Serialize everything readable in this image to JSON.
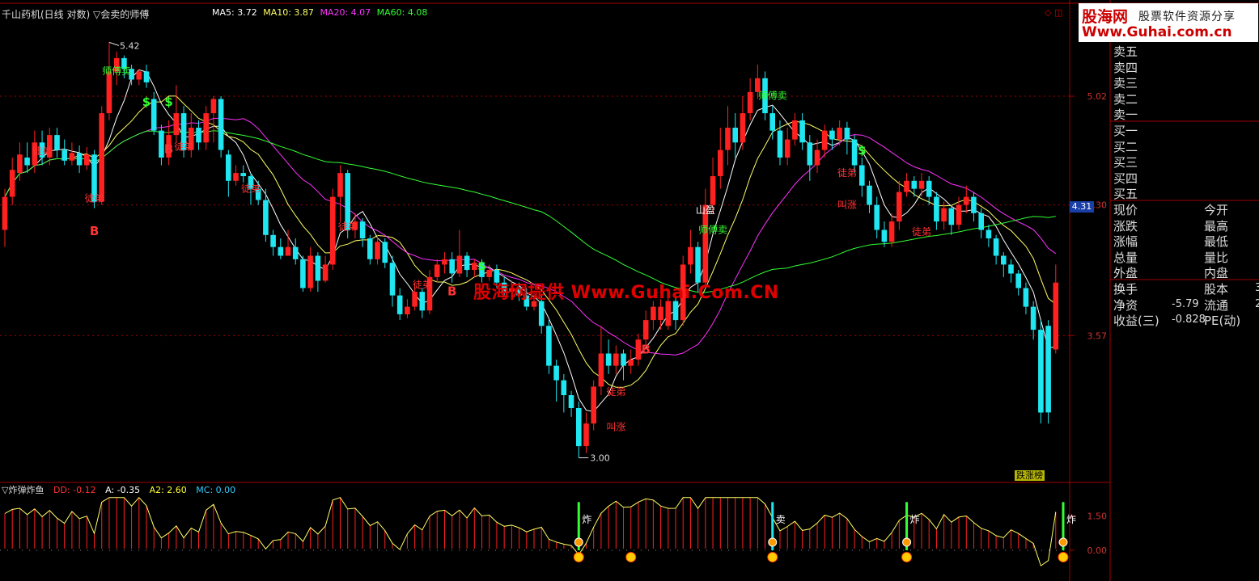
{
  "header": {
    "title": "千山药机(日线 对数) ▽会卖的师傅",
    "ma": [
      {
        "label": "MA5: 3.72",
        "color": "#ffffff"
      },
      {
        "label": "MA10: 3.87",
        "color": "#ffff66"
      },
      {
        "label": "MA20: 4.07",
        "color": "#ff33ff"
      },
      {
        "label": "MA60: 4.08",
        "color": "#33ff33"
      }
    ],
    "icons": "◇ ◫"
  },
  "logo": {
    "cn": "股海网",
    "sub": "股票软件资源分享",
    "url": "Www.Guhai.com.cn"
  },
  "watermark": "股海网提供 Www.Guhai.Com.CN",
  "indicator": {
    "name": "▽炸弹炸鱼",
    "values": [
      {
        "label": "DD: -0.12",
        "color": "#ff3333"
      },
      {
        "label": "A: -0.35",
        "color": "#ffffff"
      },
      {
        "label": "A2: 2.60",
        "color": "#ffff33"
      },
      {
        "label": "MC: 0.00",
        "color": "#33ccff"
      }
    ]
  },
  "quote": {
    "sell": [
      "卖五",
      "卖四",
      "卖三",
      "卖二",
      "卖一"
    ],
    "buy": [
      "买一",
      "买二",
      "买三",
      "买四",
      "买五"
    ],
    "left_labels": [
      "现价",
      "涨跌",
      "涨幅",
      "总量",
      "外盘"
    ],
    "right_labels": [
      "今开",
      "最高",
      "最低",
      "量比",
      "内盘"
    ],
    "extra_left": [
      "换手",
      "净资",
      "收益(三)"
    ],
    "extra_values": [
      "",
      "-5.79",
      "-0.828"
    ],
    "extra_right": [
      "股本",
      "流通",
      "PE(动)"
    ],
    "extra_right_vals": [
      "3",
      "2",
      ""
    ]
  },
  "price_tag": "4.31",
  "fall_rank": "跌涨榜",
  "chart_data": {
    "type": "candlestick",
    "title": "千山药机(日线 对数)",
    "y_axis_ticks": [
      5.02,
      4.3,
      3.57
    ],
    "y_axis_tick_labels": [
      "5.02",
      "4.30",
      "3.57"
    ],
    "ylim": [
      2.9,
      5.6
    ],
    "scale": "log",
    "high_label": "5.42",
    "low_label": "3.00",
    "candles": [
      [
        4.15,
        4.35,
        4.4,
        4.05
      ],
      [
        4.35,
        4.52,
        4.6,
        4.3
      ],
      [
        4.5,
        4.62,
        4.7,
        4.45
      ],
      [
        4.6,
        4.55,
        4.7,
        4.5
      ],
      [
        4.55,
        4.7,
        4.78,
        4.5
      ],
      [
        4.7,
        4.6,
        4.78,
        4.55
      ],
      [
        4.6,
        4.75,
        4.8,
        4.55
      ],
      [
        4.75,
        4.65,
        4.8,
        4.6
      ],
      [
        4.65,
        4.58,
        4.72,
        4.55
      ],
      [
        4.58,
        4.63,
        4.7,
        4.55
      ],
      [
        4.63,
        4.55,
        4.68,
        4.5
      ],
      [
        4.55,
        4.62,
        4.67,
        4.52
      ],
      [
        4.62,
        4.32,
        4.65,
        4.28
      ],
      [
        4.32,
        4.9,
        4.95,
        4.3
      ],
      [
        4.9,
        5.2,
        5.42,
        4.85
      ],
      [
        5.2,
        5.3,
        5.35,
        5.1
      ],
      [
        5.3,
        5.22,
        5.32,
        5.15
      ],
      [
        5.22,
        5.14,
        5.25,
        5.1
      ],
      [
        5.14,
        5.2,
        5.22,
        5.1
      ],
      [
        5.2,
        5.12,
        5.25,
        5.08
      ],
      [
        5.0,
        4.78,
        5.05,
        4.75
      ],
      [
        4.78,
        4.6,
        4.82,
        4.55
      ],
      [
        4.6,
        4.75,
        4.85,
        4.55
      ],
      [
        4.75,
        4.9,
        5.1,
        4.7
      ],
      [
        4.9,
        4.65,
        4.95,
        4.6
      ],
      [
        4.65,
        4.8,
        4.9,
        4.6
      ],
      [
        4.8,
        4.7,
        4.85,
        4.65
      ],
      [
        4.7,
        4.9,
        4.95,
        4.65
      ],
      [
        4.9,
        5.0,
        5.02,
        4.7
      ],
      [
        5.0,
        4.65,
        5.02,
        4.6
      ],
      [
        4.62,
        4.45,
        4.65,
        4.35
      ],
      [
        4.45,
        4.5,
        4.55,
        4.42
      ],
      [
        4.5,
        4.48,
        4.55,
        4.44
      ],
      [
        4.48,
        4.4,
        4.5,
        4.3
      ],
      [
        4.4,
        4.33,
        4.45,
        4.3
      ],
      [
        4.33,
        4.12,
        4.4,
        4.08
      ],
      [
        4.12,
        4.05,
        4.15,
        4.0
      ],
      [
        4.05,
        4.0,
        4.1,
        3.98
      ],
      [
        4.0,
        4.05,
        4.15,
        4.0
      ],
      [
        4.05,
        3.98,
        4.1,
        3.95
      ],
      [
        3.98,
        3.82,
        4.0,
        3.8
      ],
      [
        3.82,
        4.0,
        4.05,
        3.8
      ],
      [
        4.0,
        3.86,
        4.02,
        3.8
      ],
      [
        3.86,
        3.95,
        4.0,
        3.85
      ],
      [
        3.95,
        4.35,
        4.4,
        3.92
      ],
      [
        4.35,
        4.5,
        4.55,
        4.2
      ],
      [
        4.5,
        4.15,
        4.52,
        4.1
      ],
      [
        4.15,
        4.2,
        4.25,
        4.1
      ],
      [
        4.2,
        4.1,
        4.22,
        4.05
      ],
      [
        4.1,
        3.98,
        4.12,
        3.95
      ],
      [
        3.98,
        4.08,
        4.12,
        3.95
      ],
      [
        4.08,
        3.96,
        4.1,
        3.93
      ],
      [
        3.96,
        3.78,
        4.0,
        3.72
      ],
      [
        3.78,
        3.68,
        3.82,
        3.65
      ],
      [
        3.68,
        3.72,
        3.76,
        3.66
      ],
      [
        3.72,
        3.8,
        3.85,
        3.7
      ],
      [
        3.8,
        3.7,
        3.82,
        3.66
      ],
      [
        3.7,
        3.88,
        3.92,
        3.68
      ],
      [
        3.88,
        3.95,
        3.98,
        3.85
      ],
      [
        3.95,
        3.98,
        4.02,
        3.9
      ],
      [
        3.98,
        3.9,
        4.02,
        3.85
      ],
      [
        3.9,
        4.0,
        4.15,
        3.88
      ],
      [
        4.0,
        3.92,
        4.02,
        3.88
      ],
      [
        3.92,
        3.96,
        3.98,
        3.88
      ],
      [
        3.96,
        3.88,
        3.98,
        3.85
      ],
      [
        3.88,
        3.92,
        3.95,
        3.86
      ],
      [
        3.92,
        3.85,
        3.95,
        3.82
      ],
      [
        3.85,
        3.8,
        3.88,
        3.78
      ],
      [
        3.8,
        3.82,
        3.86,
        3.78
      ],
      [
        3.82,
        3.78,
        3.85,
        3.75
      ],
      [
        3.78,
        3.72,
        3.82,
        3.7
      ],
      [
        3.72,
        3.75,
        3.8,
        3.7
      ],
      [
        3.75,
        3.62,
        3.78,
        3.58
      ],
      [
        3.62,
        3.42,
        3.65,
        3.38
      ],
      [
        3.42,
        3.35,
        3.45,
        3.25
      ],
      [
        3.35,
        3.28,
        3.38,
        3.2
      ],
      [
        3.28,
        3.22,
        3.3,
        3.18
      ],
      [
        3.22,
        3.05,
        3.25,
        3.0
      ],
      [
        3.05,
        3.15,
        3.2,
        3.02
      ],
      [
        3.15,
        3.32,
        3.35,
        3.12
      ],
      [
        3.32,
        3.48,
        3.62,
        3.28
      ],
      [
        3.48,
        3.42,
        3.55,
        3.38
      ],
      [
        3.42,
        3.48,
        3.52,
        3.38
      ],
      [
        3.48,
        3.42,
        3.5,
        3.35
      ],
      [
        3.42,
        3.45,
        3.5,
        3.38
      ],
      [
        3.45,
        3.55,
        3.58,
        3.42
      ],
      [
        3.55,
        3.65,
        3.7,
        3.52
      ],
      [
        3.65,
        3.72,
        3.75,
        3.6
      ],
      [
        3.65,
        3.72,
        3.76,
        3.6
      ],
      [
        3.62,
        3.75,
        3.8,
        3.6
      ],
      [
        3.75,
        3.65,
        3.78,
        3.6
      ],
      [
        3.65,
        3.95,
        4.0,
        3.62
      ],
      [
        3.95,
        4.05,
        4.15,
        3.9
      ],
      [
        4.05,
        3.85,
        4.08,
        3.8
      ],
      [
        3.85,
        4.3,
        4.4,
        3.82
      ],
      [
        4.3,
        4.48,
        4.6,
        4.25
      ],
      [
        4.48,
        4.65,
        4.8,
        4.4
      ],
      [
        4.65,
        4.8,
        4.95,
        4.55
      ],
      [
        4.8,
        4.7,
        4.9,
        4.6
      ],
      [
        4.7,
        4.9,
        5.02,
        4.65
      ],
      [
        4.9,
        5.05,
        5.15,
        4.85
      ],
      [
        5.05,
        5.15,
        5.25,
        5.0
      ],
      [
        5.15,
        4.9,
        5.2,
        4.85
      ],
      [
        4.9,
        4.78,
        4.95,
        4.72
      ],
      [
        4.78,
        4.6,
        4.85,
        4.55
      ],
      [
        4.6,
        4.72,
        4.8,
        4.55
      ],
      [
        4.72,
        4.85,
        4.9,
        4.68
      ],
      [
        4.85,
        4.7,
        4.9,
        4.65
      ],
      [
        4.7,
        4.55,
        4.75,
        4.45
      ],
      [
        4.55,
        4.65,
        4.72,
        4.5
      ],
      [
        4.65,
        4.78,
        4.82,
        4.6
      ],
      [
        4.78,
        4.72,
        4.8,
        4.65
      ],
      [
        4.72,
        4.8,
        4.85,
        4.68
      ],
      [
        4.8,
        4.72,
        4.84,
        4.62
      ],
      [
        4.72,
        4.55,
        4.75,
        4.5
      ],
      [
        4.55,
        4.42,
        4.6,
        4.35
      ],
      [
        4.42,
        4.3,
        4.45,
        4.25
      ],
      [
        4.3,
        4.15,
        4.35,
        4.1
      ],
      [
        4.15,
        4.08,
        4.2,
        4.05
      ],
      [
        4.08,
        4.2,
        4.25,
        4.05
      ],
      [
        4.2,
        4.38,
        4.45,
        4.15
      ],
      [
        4.38,
        4.45,
        4.5,
        4.35
      ],
      [
        4.45,
        4.4,
        4.48,
        4.35
      ],
      [
        4.4,
        4.45,
        4.5,
        4.35
      ],
      [
        4.45,
        4.35,
        4.48,
        4.3
      ],
      [
        4.35,
        4.2,
        4.38,
        4.15
      ],
      [
        4.2,
        4.28,
        4.32,
        4.15
      ],
      [
        4.28,
        4.18,
        4.3,
        4.12
      ],
      [
        4.18,
        4.3,
        4.35,
        4.15
      ],
      [
        4.3,
        4.35,
        4.42,
        4.25
      ],
      [
        4.35,
        4.25,
        4.38,
        4.2
      ],
      [
        4.25,
        4.15,
        4.28,
        4.1
      ],
      [
        4.15,
        4.1,
        4.18,
        4.05
      ],
      [
        4.1,
        4.0,
        4.12,
        3.95
      ],
      [
        4.0,
        3.95,
        4.02,
        3.88
      ],
      [
        3.95,
        3.9,
        3.98,
        3.85
      ],
      [
        3.9,
        3.82,
        3.92,
        3.78
      ],
      [
        3.82,
        3.72,
        3.85,
        3.68
      ],
      [
        3.72,
        3.6,
        3.75,
        3.55
      ],
      [
        3.6,
        3.2,
        3.65,
        3.15
      ],
      [
        3.62,
        3.2,
        3.65,
        3.15
      ],
      [
        3.5,
        3.85,
        3.95,
        3.48
      ]
    ],
    "series": [
      {
        "name": "MA5",
        "values": [
          3.72
        ]
      },
      {
        "name": "MA10",
        "values": [
          3.87
        ]
      },
      {
        "name": "MA20",
        "values": [
          4.07
        ]
      },
      {
        "name": "MA60",
        "values": [
          4.08
        ]
      }
    ],
    "annotations": [
      {
        "text": "师傅卖",
        "index": 15,
        "price": 5.18,
        "color": "#33ff33"
      },
      {
        "text": "师傅卖",
        "index": 103,
        "price": 5.0,
        "color": "#33ff33"
      },
      {
        "text": "师傅卖",
        "index": 95,
        "price": 4.13,
        "color": "#33ff33"
      },
      {
        "text": "山盈",
        "index": 94,
        "price": 4.25,
        "color": "#ffffff"
      },
      {
        "text": "B",
        "index": 12,
        "price": 4.12,
        "color": "#ff3333"
      },
      {
        "text": "B",
        "index": 22,
        "price": 4.63,
        "color": "#ff3333"
      },
      {
        "text": "B",
        "index": 60,
        "price": 3.78,
        "color": "#ff3333"
      },
      {
        "text": "B",
        "index": 86,
        "price": 3.48,
        "color": "#ff3333"
      },
      {
        "text": "徒弟",
        "index": 5,
        "price": 4.62,
        "color": "#ff3333"
      },
      {
        "text": "徒弟",
        "index": 12,
        "price": 4.32,
        "color": "#ff3333"
      },
      {
        "text": "徒弟",
        "index": 24,
        "price": 4.65,
        "color": "#ff3333"
      },
      {
        "text": "徒弟",
        "index": 33,
        "price": 4.38,
        "color": "#ff3333"
      },
      {
        "text": "徒弟",
        "index": 46,
        "price": 4.15,
        "color": "#ff3333"
      },
      {
        "text": "徒弟",
        "index": 56,
        "price": 3.82,
        "color": "#ff3333"
      },
      {
        "text": "徒弟",
        "index": 82,
        "price": 3.28,
        "color": "#ff3333"
      },
      {
        "text": "徒弟",
        "index": 113,
        "price": 4.48,
        "color": "#ff3333"
      },
      {
        "text": "徒弟",
        "index": 123,
        "price": 4.12,
        "color": "#ff3333"
      },
      {
        "text": "叫涨",
        "index": 82,
        "price": 3.12,
        "color": "#ff3333"
      },
      {
        "text": "叫涨",
        "index": 113,
        "price": 4.28,
        "color": "#ff3333"
      },
      {
        "text": "$",
        "index": 19,
        "price": 4.95,
        "color": "#33ff33"
      },
      {
        "text": "$",
        "index": 22,
        "price": 4.95,
        "color": "#33ff33"
      },
      {
        "text": "$",
        "index": 64,
        "price": 3.92,
        "color": "#33ff33"
      },
      {
        "text": "$",
        "index": 115,
        "price": 4.62,
        "color": "#33ff33"
      }
    ],
    "indicator_ticks": [
      1.5,
      0.0
    ],
    "indicator_tick_labels": [
      "1.50",
      "0.00"
    ],
    "indicator_ylim": [
      -1.2,
      2.5
    ],
    "indicator_labels": [
      {
        "text": "炸",
        "index": 77
      },
      {
        "text": "卖",
        "index": 103
      },
      {
        "text": "炸",
        "index": 121
      },
      {
        "text": "炸",
        "index": 142
      }
    ],
    "grid": true
  }
}
